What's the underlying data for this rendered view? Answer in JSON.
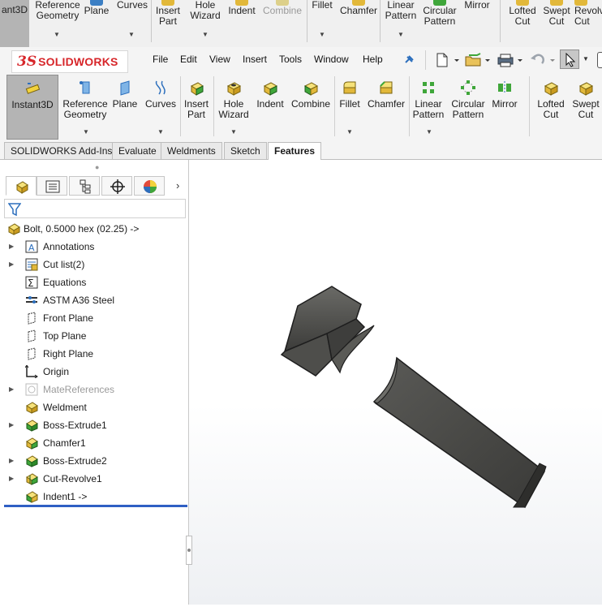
{
  "background_ribbon": {
    "items": [
      {
        "label": "ant3D",
        "disabled": false
      },
      {
        "label": "Reference Geometry",
        "disabled": false
      },
      {
        "label": "Plane",
        "disabled": false
      },
      {
        "label": "Curves",
        "disabled": false
      },
      {
        "label": "Insert Part",
        "disabled": false
      },
      {
        "label": "Hole Wizard",
        "disabled": false
      },
      {
        "label": "Indent",
        "disabled": false
      },
      {
        "label": "Combine",
        "disabled": true
      },
      {
        "label": "Fillet",
        "disabled": false
      },
      {
        "label": "Chamfer",
        "disabled": false
      },
      {
        "label": "Linear Pattern",
        "disabled": false
      },
      {
        "label": "Circular Pattern",
        "disabled": false
      },
      {
        "label": "Mirror",
        "disabled": false
      },
      {
        "label": "Lofted Cut",
        "disabled": false
      },
      {
        "label": "Swept Cut",
        "disabled": false
      },
      {
        "label": "Revolv Cut",
        "disabled": false
      }
    ]
  },
  "app": {
    "logo_ds": "3S",
    "logo_name": "SOLIDWORKS",
    "menus": [
      "File",
      "Edit",
      "View",
      "Insert",
      "Tools",
      "Window",
      "Help"
    ]
  },
  "toolbar_icons": [
    "pin-icon",
    "new-document-icon",
    "open-folder-icon",
    "print-icon",
    "undo-icon",
    "select-arrow-icon"
  ],
  "command_manager": {
    "items": [
      {
        "label": "Instant3D",
        "active": true,
        "icon": "instant3d-icon"
      },
      {
        "label": "Reference Geometry",
        "icon": "reference-geometry-icon"
      },
      {
        "label": "Plane",
        "icon": "plane-icon"
      },
      {
        "label": "Curves",
        "icon": "curves-icon"
      },
      {
        "label": "Insert Part",
        "icon": "insert-part-icon"
      },
      {
        "label": "Hole Wizard",
        "icon": "hole-wizard-icon"
      },
      {
        "label": "Indent",
        "icon": "indent-icon"
      },
      {
        "label": "Combine",
        "icon": "combine-icon"
      },
      {
        "label": "Fillet",
        "icon": "fillet-icon"
      },
      {
        "label": "Chamfer",
        "icon": "chamfer-icon"
      },
      {
        "label": "Linear Pattern",
        "icon": "linear-pattern-icon"
      },
      {
        "label": "Circular Pattern",
        "icon": "circular-pattern-icon"
      },
      {
        "label": "Mirror",
        "icon": "mirror-icon"
      },
      {
        "label": "Lofted Cut",
        "icon": "lofted-cut-icon"
      },
      {
        "label": "Swept Cut",
        "icon": "swept-cut-icon"
      }
    ]
  },
  "tabs": [
    {
      "label": "SOLIDWORKS Add-Ins",
      "selected": false
    },
    {
      "label": "Evaluate",
      "selected": false
    },
    {
      "label": "Weldments",
      "selected": false
    },
    {
      "label": "Sketch",
      "selected": false
    },
    {
      "label": "Features",
      "selected": true
    }
  ],
  "feature_manager": {
    "panel_tabs": [
      "feature-manager-tab-icon",
      "property-manager-tab-icon",
      "configuration-manager-tab-icon",
      "dimxpert-tab-icon",
      "display-manager-tab-icon"
    ],
    "root": "Bolt, 0.5000 hex  (02.25) ->",
    "tree": [
      {
        "label": "Annotations",
        "expandable": true,
        "icon": "annotations-icon"
      },
      {
        "label": "Cut list(2)",
        "expandable": true,
        "icon": "cut-list-icon"
      },
      {
        "label": "Equations",
        "expandable": false,
        "icon": "equations-icon"
      },
      {
        "label": "ASTM A36 Steel",
        "expandable": false,
        "icon": "material-icon"
      },
      {
        "label": "Front Plane",
        "expandable": false,
        "icon": "plane-icon"
      },
      {
        "label": "Top Plane",
        "expandable": false,
        "icon": "plane-icon"
      },
      {
        "label": "Right Plane",
        "expandable": false,
        "icon": "plane-icon"
      },
      {
        "label": "Origin",
        "expandable": false,
        "icon": "origin-icon"
      },
      {
        "label": "MateReferences",
        "expandable": true,
        "icon": "mate-references-icon",
        "dim": true
      },
      {
        "label": "Weldment",
        "expandable": false,
        "icon": "weldment-icon"
      },
      {
        "label": "Boss-Extrude1",
        "expandable": true,
        "icon": "boss-extrude-icon"
      },
      {
        "label": "Chamfer1",
        "expandable": false,
        "icon": "chamfer-feature-icon"
      },
      {
        "label": "Boss-Extrude2",
        "expandable": true,
        "icon": "boss-extrude-icon"
      },
      {
        "label": "Cut-Revolve1",
        "expandable": true,
        "icon": "cut-revolve-icon"
      },
      {
        "label": "Indent1 ->",
        "expandable": false,
        "icon": "indent-feature-icon"
      }
    ]
  },
  "colors": {
    "brand_red": "#d7262a",
    "rollback_bar": "#2f5fc4",
    "model_gray": "#4a4a48",
    "feature_yellow": "#f2d23b",
    "feature_green": "#3fa63a"
  }
}
